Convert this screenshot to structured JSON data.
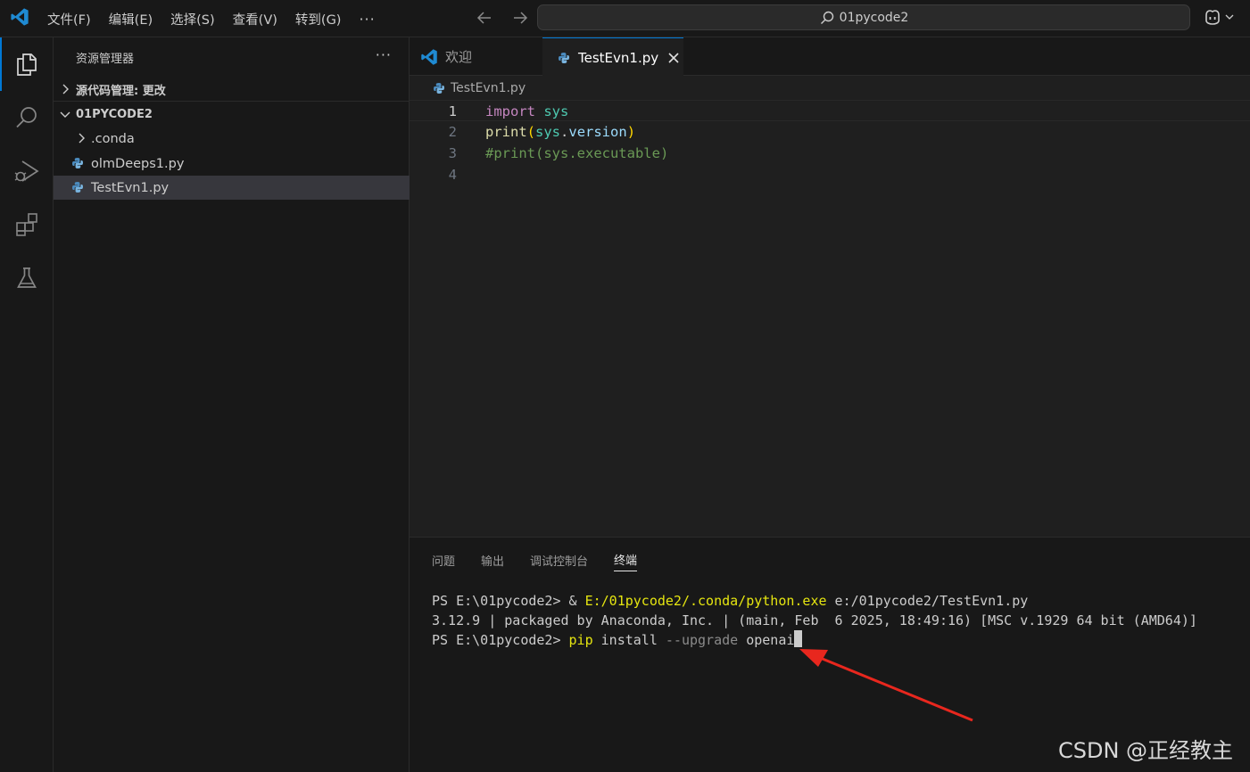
{
  "titlebar": {
    "menu": [
      "文件(F)",
      "编辑(E)",
      "选择(S)",
      "查看(V)",
      "转到(G)"
    ],
    "more": "···",
    "search_text": "01pycode2"
  },
  "sidebar": {
    "title": "资源管理器",
    "more": "···",
    "source_control_label": "源代码管理: 更改",
    "folder_label": "01PYCODE2",
    "items": [
      {
        "label": ".conda",
        "type": "folder"
      },
      {
        "label": "olmDeeps1.py",
        "type": "python"
      },
      {
        "label": "TestEvn1.py",
        "type": "python"
      }
    ]
  },
  "editor": {
    "tabs": [
      {
        "label": "欢迎",
        "icon": "vscode-icon"
      },
      {
        "label": "TestEvn1.py",
        "icon": "python-icon"
      }
    ],
    "breadcrumb": "TestEvn1.py",
    "lines": [
      {
        "num": "1",
        "kw": "import",
        "mod": "sys"
      },
      {
        "num": "2",
        "fn": "print",
        "open": "(",
        "obj": "sys",
        "dot": ".",
        "attr": "version",
        "close": ")"
      },
      {
        "num": "3",
        "comment": "#print(sys.executable)"
      },
      {
        "num": "4"
      }
    ]
  },
  "panel": {
    "tabs": [
      "问题",
      "输出",
      "调试控制台",
      "终端"
    ],
    "terminal": {
      "line1_prompt": "PS E:\\01pycode2> ",
      "line1_amp": "& ",
      "line1_exe": "E:/01pycode2/.conda/python.exe",
      "line1_arg": " e:/01pycode2/TestEvn1.py",
      "line2": "3.12.9 | packaged by Anaconda, Inc. | (main, Feb  6 2025, 18:49:16) [MSC v.1929 64 bit (AMD64)]",
      "line3_prompt": "PS E:\\01pycode2> ",
      "line3_cmd": "pip",
      "line3_install": " install ",
      "line3_flag": "--upgrade",
      "line3_pkg": " openai"
    }
  },
  "watermark": "CSDN @正经教主",
  "colors": {
    "accent": "#0078d4",
    "arrow": "#e8271e"
  }
}
